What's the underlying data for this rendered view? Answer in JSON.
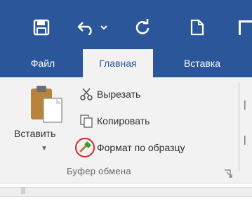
{
  "quick_access": {
    "save_icon": "save-icon",
    "undo_icon": "undo-icon",
    "undo_dropdown_icon": "chevron-down-icon",
    "redo_icon": "redo-icon",
    "new_icon": "new-document-icon"
  },
  "tabs": [
    {
      "label": "Файл"
    },
    {
      "label": "Главная",
      "active": true
    },
    {
      "label": "Вставка"
    }
  ],
  "clipboard": {
    "paste_label": "Вставить",
    "cut_label": "Вырезать",
    "copy_label": "Копировать",
    "format_painter_label": "Формат по образцу",
    "group_label": "Буфер обмена"
  },
  "colors": {
    "title_bar": "#2b579a",
    "ribbon_bg": "#f2f2f2",
    "highlight_circle": "#d9262b"
  }
}
